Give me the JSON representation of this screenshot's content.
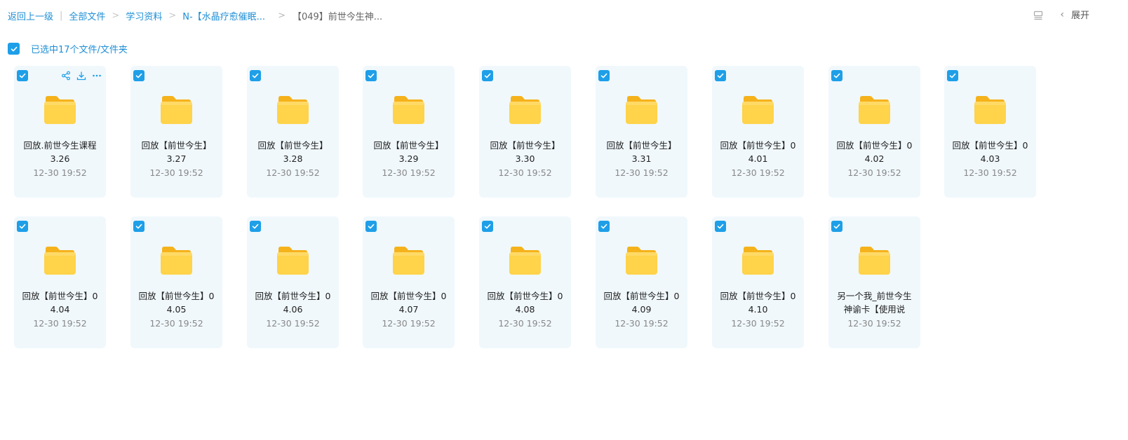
{
  "breadcrumb": {
    "back": "返回上一级",
    "all_files": "全部文件",
    "study": "学习资料",
    "crystal": "N-【水晶疗愈催眠...",
    "current": "【049】前世今生神..."
  },
  "toolbar": {
    "expand_label": "展开"
  },
  "selection": {
    "label": "已选中17个文件/文件夹"
  },
  "colors": {
    "accent": "#1e9fe8",
    "card_bg": "#f0f8fc",
    "folder": "#ffcf3a"
  },
  "files": [
    {
      "line1": "回放.前世今生课程",
      "line2": "3.26",
      "date": "12-30 19:52"
    },
    {
      "line1": "回放【前世今生】",
      "line2": "3.27",
      "date": "12-30 19:52"
    },
    {
      "line1": "回放【前世今生】",
      "line2": "3.28",
      "date": "12-30 19:52"
    },
    {
      "line1": "回放【前世今生】",
      "line2": "3.29",
      "date": "12-30 19:52"
    },
    {
      "line1": "回放【前世今生】",
      "line2": "3.30",
      "date": "12-30 19:52"
    },
    {
      "line1": "回放【前世今生】",
      "line2": "3.31",
      "date": "12-30 19:52"
    },
    {
      "line1": "回放【前世今生】0",
      "line2": "4.01",
      "date": "12-30 19:52"
    },
    {
      "line1": "回放【前世今生】0",
      "line2": "4.02",
      "date": "12-30 19:52"
    },
    {
      "line1": "回放【前世今生】0",
      "line2": "4.03",
      "date": "12-30 19:52"
    },
    {
      "line1": "回放【前世今生】0",
      "line2": "4.04",
      "date": "12-30 19:52"
    },
    {
      "line1": "回放【前世今生】0",
      "line2": "4.05",
      "date": "12-30 19:52"
    },
    {
      "line1": "回放【前世今生】0",
      "line2": "4.06",
      "date": "12-30 19:52"
    },
    {
      "line1": "回放【前世今生】0",
      "line2": "4.07",
      "date": "12-30 19:52"
    },
    {
      "line1": "回放【前世今生】0",
      "line2": "4.08",
      "date": "12-30 19:52"
    },
    {
      "line1": "回放【前世今生】0",
      "line2": "4.09",
      "date": "12-30 19:52"
    },
    {
      "line1": "回放【前世今生】0",
      "line2": "4.10",
      "date": "12-30 19:52"
    },
    {
      "line1": "另一个我_前世今生",
      "line2": "神谕卡【使用说",
      "date": "12-30 19:52"
    }
  ]
}
